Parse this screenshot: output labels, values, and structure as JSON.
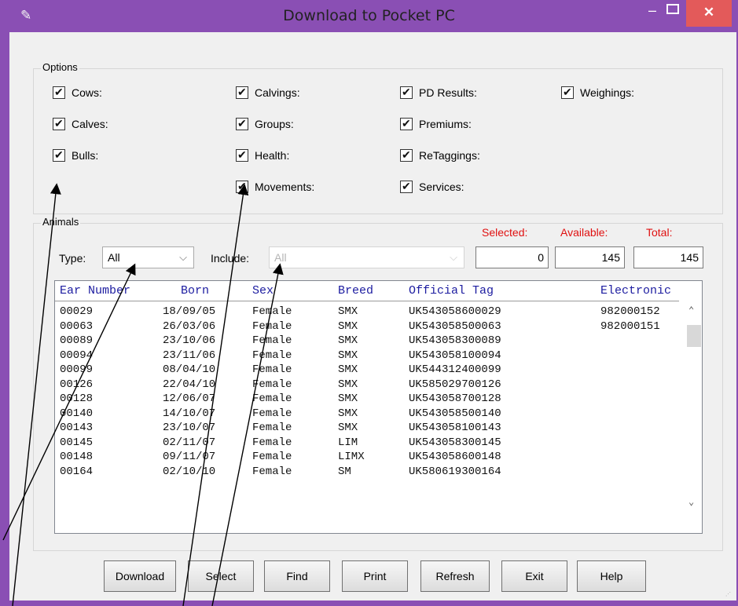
{
  "window": {
    "title": "Download to Pocket PC",
    "minimize": "–",
    "close": "✕"
  },
  "options": {
    "group_label": "Options",
    "columns": [
      [
        {
          "label": "Cows:",
          "checked": true
        },
        {
          "label": "Calves:",
          "checked": true
        },
        {
          "label": "Bulls:",
          "checked": true
        }
      ],
      [
        {
          "label": "Calvings:",
          "checked": true
        },
        {
          "label": "Groups:",
          "checked": true
        },
        {
          "label": "Health:",
          "checked": true
        },
        {
          "label": "Movements:",
          "checked": true
        }
      ],
      [
        {
          "label": "PD Results:",
          "checked": true
        },
        {
          "label": "Premiums:",
          "checked": true
        },
        {
          "label": "ReTaggings:",
          "checked": true
        },
        {
          "label": "Services:",
          "checked": true
        }
      ],
      [
        {
          "label": "Weighings:",
          "checked": true
        }
      ]
    ]
  },
  "animals": {
    "group_label": "Animals",
    "type_label": "Type:",
    "type_value": "All",
    "include_label": "Include:",
    "include_value": "All",
    "selected_label": "Selected:",
    "available_label": "Available:",
    "total_label": "Total:",
    "selected": "0",
    "available": "145",
    "total": "145",
    "columns": [
      "Ear Number",
      "Born",
      "Sex",
      "Breed",
      "Official Tag",
      "Electronic"
    ],
    "rows": [
      [
        "00029",
        "18/09/05",
        "Female",
        "SMX",
        "UK543058600029",
        "982000152"
      ],
      [
        "00063",
        "26/03/06",
        "Female",
        "SMX",
        "UK543058500063",
        "982000151"
      ],
      [
        "00089",
        "23/10/06",
        "Female",
        "SMX",
        "UK543058300089",
        ""
      ],
      [
        "00094",
        "23/11/06",
        "Female",
        "SMX",
        "UK543058100094",
        ""
      ],
      [
        "00099",
        "08/04/10",
        "Female",
        "SMX",
        "UK544312400099",
        ""
      ],
      [
        "00126",
        "22/04/10",
        "Female",
        "SMX",
        "UK585029700126",
        ""
      ],
      [
        "00128",
        "12/06/07",
        "Female",
        "SMX",
        "UK543058700128",
        ""
      ],
      [
        "00140",
        "14/10/07",
        "Female",
        "SMX",
        "UK543058500140",
        ""
      ],
      [
        "00143",
        "23/10/07",
        "Female",
        "SMX",
        "UK543058100143",
        ""
      ],
      [
        "00145",
        "02/11/07",
        "Female",
        "LIM",
        "UK543058300145",
        ""
      ],
      [
        "00148",
        "09/11/07",
        "Female",
        "LIMX",
        "UK543058600148",
        ""
      ],
      [
        "00164",
        "02/10/10",
        "Female",
        "SM",
        "UK580619300164",
        ""
      ]
    ]
  },
  "buttons": [
    "Download",
    "Select",
    "Find",
    "Print",
    "Refresh",
    "Exit",
    "Help"
  ],
  "colors": {
    "titlebar": "#8a4fb4",
    "close_button": "#e35a5a",
    "count_labels": "#e01010",
    "grid_header": "#1c1ca0"
  }
}
